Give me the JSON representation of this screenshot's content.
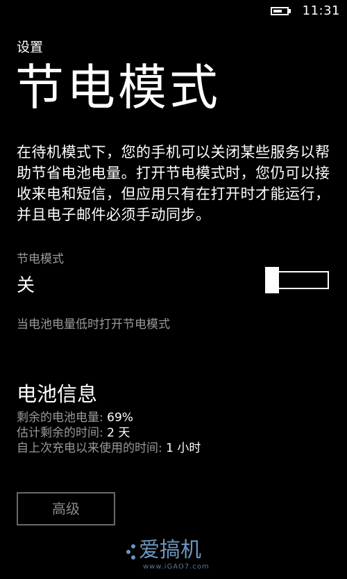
{
  "status_bar": {
    "time": "11:31",
    "battery_level": 0.69
  },
  "header": {
    "breadcrumb": "设置",
    "title": "节电模式"
  },
  "description": "在待机模式下，您的手机可以关闭某些服务以帮助节省电池电量。打开节电模式时，您仍可以接收来电和短信，但应用只有在打开时才能运行，并且电子邮件必须手动同步。",
  "battery_saver": {
    "label": "节电模式",
    "state": "关",
    "is_on": false,
    "low_battery_option": "当电池电量低时打开节电模式"
  },
  "battery_info": {
    "title": "电池信息",
    "rows": [
      {
        "label": "剩余的电池电量: ",
        "value": "69%"
      },
      {
        "label": "估计剩余的时间: ",
        "value": "2 天"
      },
      {
        "label": "自上次充电以来使用的时间: ",
        "value": "1 小时"
      }
    ]
  },
  "advanced_button_label": "高级",
  "watermark": {
    "brand": "爱搞机",
    "url": "www.iGAO7.com"
  },
  "colors": {
    "background": "#000000",
    "text": "#ffffff",
    "secondary_text": "#9a9a9a",
    "watermark": "#7fb2e0"
  }
}
